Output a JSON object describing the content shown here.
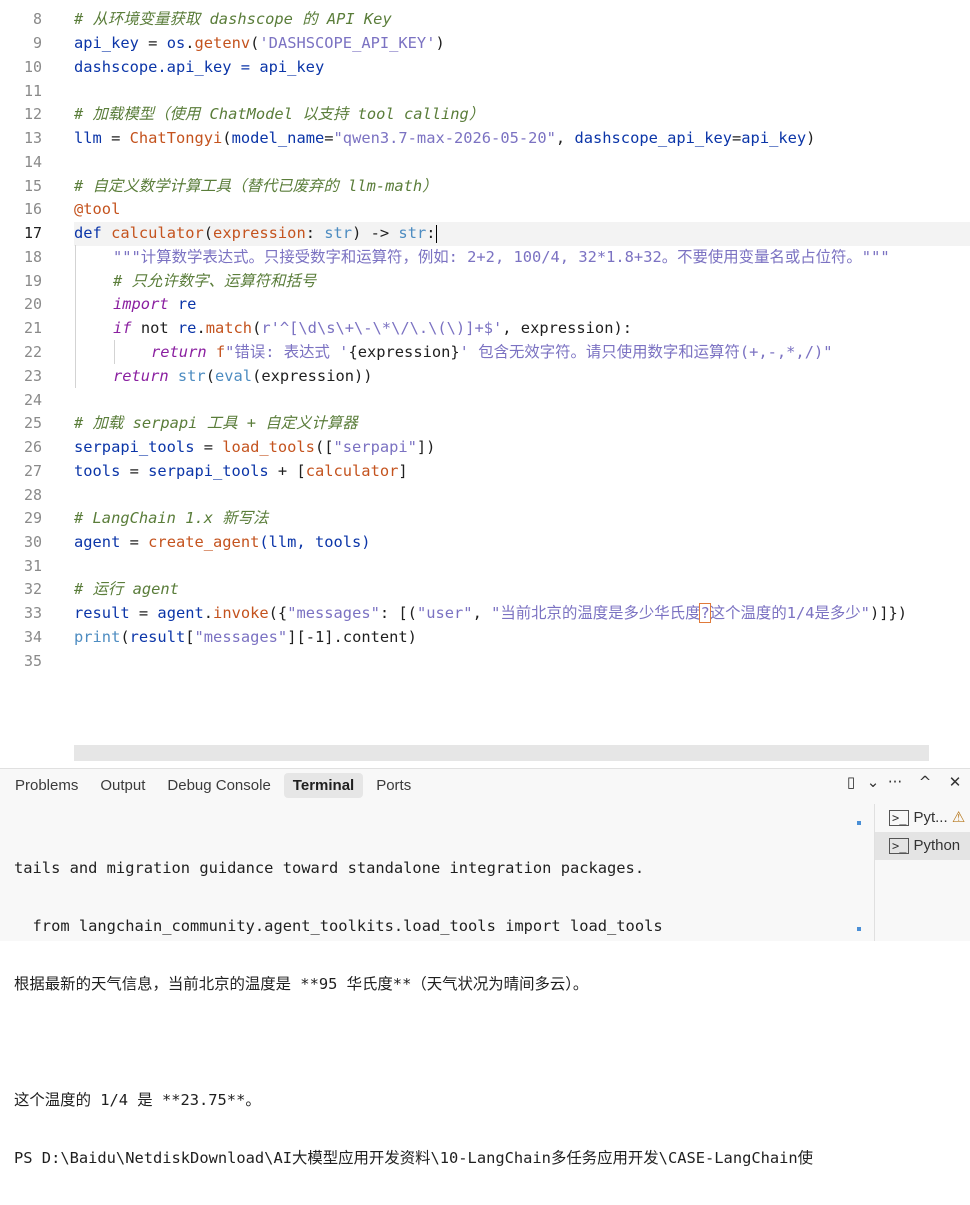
{
  "editor": {
    "line_numbers": [
      "8",
      "9",
      "10",
      "11",
      "12",
      "13",
      "14",
      "15",
      "16",
      "17",
      "18",
      "19",
      "20",
      "21",
      "22",
      "23",
      "24",
      "25",
      "26",
      "27",
      "28",
      "29",
      "30",
      "31",
      "32",
      "33",
      "34",
      "35"
    ],
    "active_line": "17",
    "code": {
      "l8": "# 从环境变量获取 dashscope 的 API Key",
      "l9_a": "api_key",
      "l9_b": " = ",
      "l9_c": "os",
      "l9_d": ".",
      "l9_e": "getenv",
      "l9_f": "(",
      "l9_g": "'DASHSCOPE_API_KEY'",
      "l9_h": ")",
      "l10_a": "dashscope",
      "l10_b": ".api_key = ",
      "l10_c": "api_key",
      "l12": "# 加载模型（使用 ChatModel 以支持 tool calling）",
      "l13_a": "llm",
      "l13_b": " = ",
      "l13_c": "ChatTongyi",
      "l13_d": "(",
      "l13_e": "model_name",
      "l13_f": "=",
      "l13_g": "\"qwen3.7-max-2026-05-20\"",
      "l13_h": ", ",
      "l13_i": "dashscope_api_key",
      "l13_j": "=",
      "l13_k": "api_key",
      "l13_l": ")",
      "l15": "# 自定义数学计算工具（替代已废弃的 llm-math）",
      "l16": "@tool",
      "l17_a": "def",
      "l17_b": " ",
      "l17_c": "calculator",
      "l17_d": "(",
      "l17_e": "expression",
      "l17_f": ": ",
      "l17_g": "str",
      "l17_h": ") -> ",
      "l17_i": "str",
      "l17_j": ":",
      "l18": "\"\"\"计算数学表达式。只接受数字和运算符，例如: 2+2, 100/4, 32*1.8+32。不要使用变量名或占位符。\"\"\"",
      "l19": "# 只允许数字、运算符和括号",
      "l20_a": "import",
      "l20_b": " re",
      "l21_a": "if",
      "l21_b": " not ",
      "l21_c": "re",
      "l21_d": ".",
      "l21_e": "match",
      "l21_f": "(",
      "l21_g": "r'^[\\d\\s\\+\\-\\*\\/\\.\\(\\)]+$'",
      "l21_h": ", expression):",
      "l22_a": "return",
      "l22_b": " f",
      "l22_c": "\"错误: 表达式 '",
      "l22_d": "{expression}",
      "l22_e": "' 包含无效字符。请只使用数字和运算符(+,-,*,/)\"",
      "l23_a": "return",
      "l23_b": " ",
      "l23_c": "str",
      "l23_d": "(",
      "l23_e": "eval",
      "l23_f": "(expression))",
      "l25": "# 加载 serpapi 工具 + 自定义计算器",
      "l26_a": "serpapi_tools",
      "l26_b": " = ",
      "l26_c": "load_tools",
      "l26_d": "([",
      "l26_e": "\"serpapi\"",
      "l26_f": "])",
      "l27_a": "tools",
      "l27_b": " = ",
      "l27_c": "serpapi_tools",
      "l27_d": " + [",
      "l27_e": "calculator",
      "l27_f": "]",
      "l29": "# LangChain 1.x 新写法",
      "l30_a": "agent",
      "l30_b": " = ",
      "l30_c": "create_agent",
      "l30_d": "(llm, tools)",
      "l32": "# 运行 agent",
      "l33_a": "result",
      "l33_b": " = ",
      "l33_c": "agent",
      "l33_d": ".",
      "l33_e": "invoke",
      "l33_f": "({",
      "l33_g": "\"messages\"",
      "l33_h": ": [(",
      "l33_i": "\"user\"",
      "l33_j": ", ",
      "l33_k": "\"当前北京的温度是多少华氏度",
      "l33_l": "?",
      "l33_m": "这个温度的1/4是多少\"",
      "l33_n": ")]})",
      "l34_a": "print",
      "l34_b": "(",
      "l34_c": "result",
      "l34_d": "[",
      "l34_e": "\"messages\"",
      "l34_f": "][",
      "l34_g": "-1",
      "l34_h": "].content)"
    }
  },
  "panel": {
    "tabs": [
      "Problems",
      "Output",
      "Debug Console",
      "Terminal",
      "Ports"
    ],
    "active_tab": "Terminal",
    "actions": {
      "layout": "▯",
      "chevron": "⌄",
      "more": "···",
      "maximize": "^",
      "close": "✕"
    },
    "terminal_lines": [
      "tails and migration guidance toward standalone integration packages.",
      "  from langchain_community.agent_toolkits.load_tools import load_tools",
      "根据最新的天气信息，当前北京的温度是 **95 华氏度**（天气状况为晴间多云）。",
      "",
      "这个温度的 1/4 是 **23.75**。",
      "PS D:\\Baidu\\NetdiskDownload\\AI大模型应用开发资料\\10-LangChain多任务应用开发\\CASE-LangChain使"
    ],
    "terminal_instances": [
      {
        "label": "Pyt...",
        "icon": ">_",
        "warning": "⚠"
      },
      {
        "label": "Python",
        "icon": ">_"
      }
    ]
  }
}
